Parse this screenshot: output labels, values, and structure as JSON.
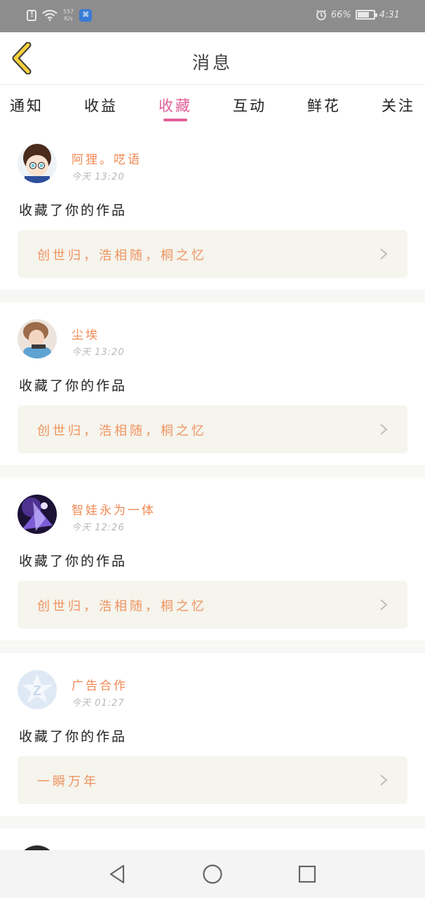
{
  "status_bar": {
    "speed_value": "557",
    "speed_unit": "K/s",
    "battery": "66%",
    "time": "4:31"
  },
  "header": {
    "title": "消息",
    "back_icon": "chevron-left-icon"
  },
  "tabs": [
    {
      "label": "通知",
      "active": false
    },
    {
      "label": "收益",
      "active": false
    },
    {
      "label": "收藏",
      "active": true
    },
    {
      "label": "互动",
      "active": false
    },
    {
      "label": "鲜花",
      "active": false
    },
    {
      "label": "关注",
      "active": false
    }
  ],
  "colors": {
    "accent": "#e0609a",
    "username": "#f08a55",
    "work_title": "#ef9460",
    "work_bg": "#f5f4ed"
  },
  "notifications": [
    {
      "username": "阿狸。呓语",
      "time": "今天 13:20",
      "action": "收藏了你的作品",
      "work": "创世归，浩相随，桐之忆"
    },
    {
      "username": "尘埃",
      "time": "今天 13:20",
      "action": "收藏了你的作品",
      "work": "创世归，浩相随，桐之忆"
    },
    {
      "username": "智娃永为一体",
      "time": "今天 12:26",
      "action": "收藏了你的作品",
      "work": "创世归，浩相随，桐之忆"
    },
    {
      "username": "广告合作",
      "time": "今天 01:27",
      "action": "收藏了你的作品",
      "work": "一瞬万年"
    }
  ],
  "nav": {
    "back_icon": "triangle-back-icon",
    "home_icon": "circle-home-icon",
    "recents_icon": "square-recents-icon"
  }
}
